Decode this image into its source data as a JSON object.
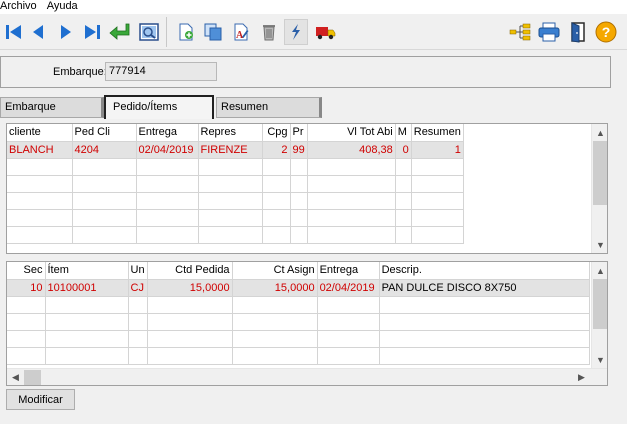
{
  "menu": [
    "Archivo",
    "Ayuda"
  ],
  "toolbar": {
    "left": [
      "first-record-icon",
      "previous-record-icon",
      "next-record-icon",
      "last-record-icon",
      "return-arrow-icon",
      "preview-icon",
      "new-document-icon",
      "copy-icon",
      "edit-document-icon",
      "delete-trash-icon",
      "lightning-icon",
      "delivery-truck-icon"
    ],
    "right": [
      "tree-structure-icon",
      "printer-icon",
      "exit-door-icon",
      "help-icon"
    ]
  },
  "header": {
    "embarque_label": "Embarque:",
    "embarque_value": "777914"
  },
  "tabs": [
    "Embarque",
    "Pedido/Ítems",
    "Resumen"
  ],
  "active_tab": "Pedido/Ítems",
  "grid1": {
    "headers": [
      "cliente",
      "Ped Cli",
      "Entrega",
      "Repres",
      "Cpg",
      "Pr",
      "Vl Tot Abi",
      "M",
      "Resumen"
    ],
    "rows": [
      [
        "BLANCH",
        "4204",
        "02/04/2019",
        "FIRENZE",
        "2",
        "99",
        "408,38",
        "0",
        "1"
      ]
    ]
  },
  "grid2": {
    "headers": [
      "Sec",
      "Ítem",
      "Un",
      "Ctd Pedida",
      "Ct Asign",
      "Entrega",
      "Descrip."
    ],
    "rows": [
      [
        "10",
        "10100001",
        "CJ",
        "15,0000",
        "15,0000",
        "02/04/2019",
        "PAN DULCE DISCO 8X750"
      ]
    ]
  },
  "buttons": {
    "modificar": "Modificar"
  },
  "colors": {
    "red_text": "#d00000",
    "selected_row": "#e3e3e3",
    "help_icon": "#f5a800"
  }
}
